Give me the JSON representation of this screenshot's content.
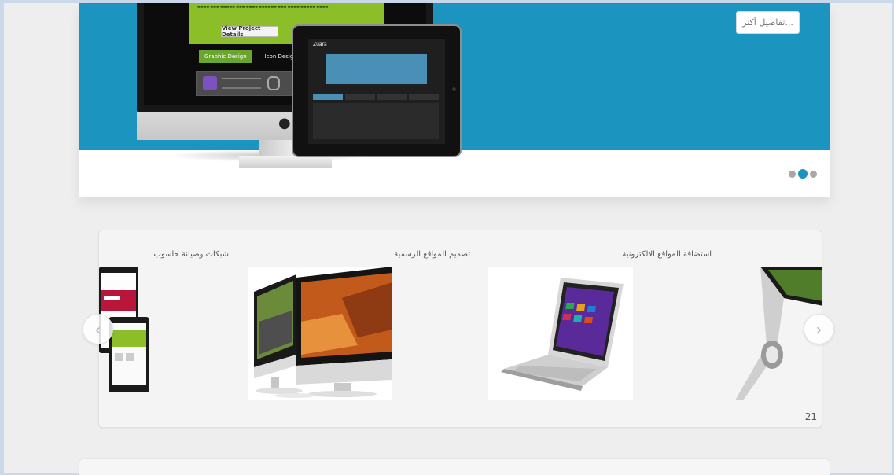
{
  "hero": {
    "more_button_label": "تفاصيل أكثر...",
    "slide_count": 3,
    "active_slide": 2,
    "preview": {
      "view_button": "View Project Details",
      "tabs": [
        "Graphic Design",
        "Icon Design"
      ],
      "ipad_logo": "Zuara"
    }
  },
  "services": {
    "items": [
      {
        "title": "استضافة المواقع الالكترونية"
      },
      {
        "title": "تصميم المواقع الرسمية"
      },
      {
        "title": "شبكات وصيانة حاسوب"
      }
    ],
    "page_number": "21"
  },
  "icons": {
    "prev": "chevron-left-icon",
    "next": "chevron-right-icon"
  },
  "colors": {
    "accent": "#1b95c0",
    "background": "#eeeeee",
    "panel": "#f4f4f4"
  }
}
